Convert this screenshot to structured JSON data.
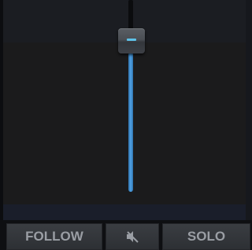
{
  "buttons": {
    "follow_label": "FOLLOW",
    "mute_icon": "speaker-muted-icon",
    "solo_label": "SOLO"
  },
  "fader": {
    "level": 0.88
  },
  "colors": {
    "accent_blue": "#4fa3e6",
    "knob_indicator": "#5ec2e8",
    "button_text": "#9a9ea4"
  }
}
